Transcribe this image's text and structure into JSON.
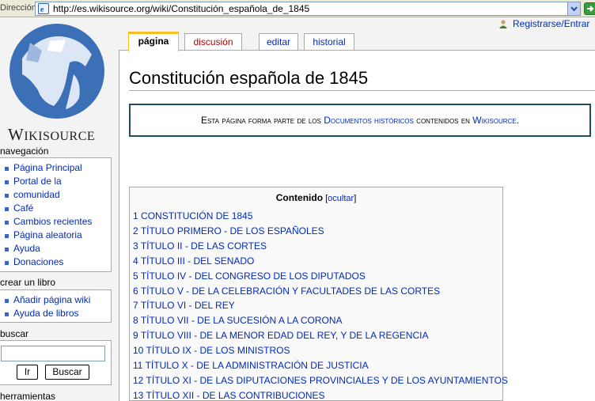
{
  "browser": {
    "address_label": "Dirección",
    "url": "http://es.wikisource.org/wiki/Constitución_española_de_1845"
  },
  "user": {
    "login_label": "Registrarse/Entrar"
  },
  "logo": {
    "text_big": "W",
    "text_rest": "IKISOURCE"
  },
  "tabs": [
    {
      "label": "página"
    },
    {
      "label": "discusión"
    },
    {
      "label": "editar"
    },
    {
      "label": "historial"
    }
  ],
  "sidebar": {
    "navigation_title": "navegación",
    "navigation_items": [
      "Página Principal",
      "Portal de la",
      "comunidad",
      "Café",
      "Cambios recientes",
      "Página aleatoria",
      "Ayuda",
      "Donaciones"
    ],
    "book_title": "crear un libro",
    "book_items": [
      "Añadir página wiki",
      "Ayuda de libros"
    ],
    "search_title": "buscar",
    "search_value": "",
    "go_label": "Ir",
    "search_label": "Buscar",
    "tools_title": "herramientas"
  },
  "page": {
    "title": "Constitución española de 1845",
    "notice_prefix": "Esta página forma parte de los ",
    "notice_link1": "Documentos históricos",
    "notice_middle": " contenidos en ",
    "notice_link2": "Wikisource",
    "notice_suffix": "."
  },
  "toc": {
    "title": "Contenido",
    "hide_open": " [",
    "hide_label": "ocultar",
    "hide_close": "]",
    "items": [
      {
        "num": "1",
        "text": "CONSTITUCIÓN DE 1845"
      },
      {
        "num": "2",
        "text": "TÍTULO PRIMERO - DE LOS ESPAÑOLES"
      },
      {
        "num": "3",
        "text": "TÍTULO II - DE LAS CORTES"
      },
      {
        "num": "4",
        "text": "TÍTULO III - DEL SENADO"
      },
      {
        "num": "5",
        "text": "TÍTULO IV - DEL CONGRESO DE LOS DIPUTADOS"
      },
      {
        "num": "6",
        "text": "TÍTULO V - DE LA CELEBRACIÓN Y FACULTADES DE LAS CORTES"
      },
      {
        "num": "7",
        "text": "TÍTULO VI - DEL REY"
      },
      {
        "num": "8",
        "text": "TÍTULO VII - DE LA SUCESIÓN A LA CORONA"
      },
      {
        "num": "9",
        "text": "TÍTULO VIII - DE LA MENOR EDAD DEL REY, Y DE LA REGENCIA"
      },
      {
        "num": "10",
        "text": "TÍTULO IX - DE LOS MINISTROS"
      },
      {
        "num": "11",
        "text": "TÍTULO X - DE LA ADMINISTRACIÓN DE JUSTICIA"
      },
      {
        "num": "12",
        "text": "TÍTULO XI - DE LAS DIPUTACIONES PROVINCIALES Y DE LOS AYUNTAMIENTOS"
      },
      {
        "num": "13",
        "text": "TÍTULO XII - DE LAS CONTRIBUCIONES"
      }
    ]
  },
  "colors": {
    "link": "#002bb8",
    "new_link": "#ba0000",
    "selected_tab": "#fabd23",
    "notice_border": "#1f4d66"
  }
}
